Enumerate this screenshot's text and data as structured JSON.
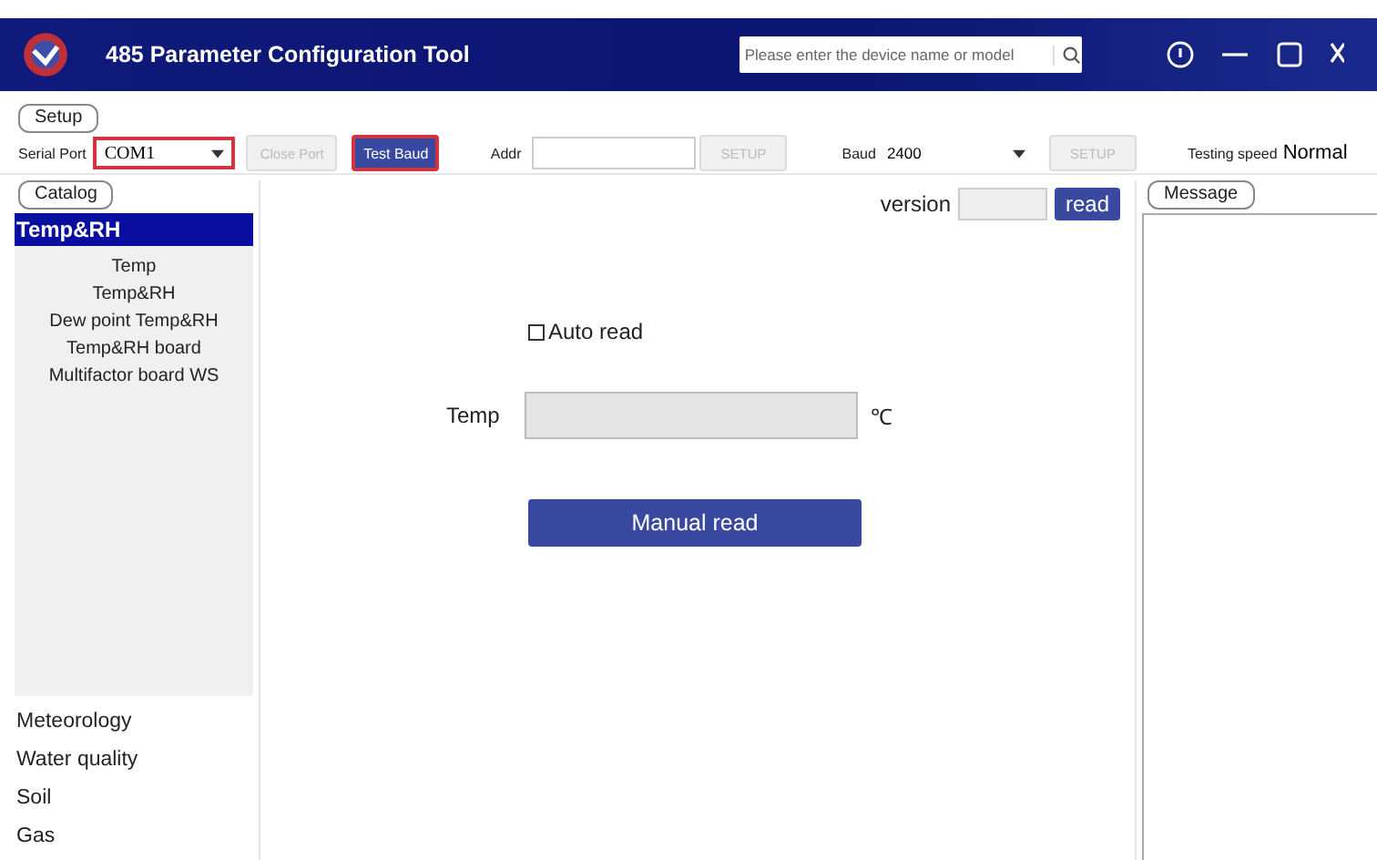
{
  "window": {
    "title": "485 Parameter Configuration Tool"
  },
  "search": {
    "placeholder": "Please enter the device name or model"
  },
  "setup": {
    "title": "Setup",
    "serial_port": {
      "label": "Serial Port",
      "value": "COM1",
      "highlighted": true
    },
    "close_port": {
      "label": "Close Port",
      "disabled": true
    },
    "test_baud": {
      "label": "Test Baud",
      "highlighted": true
    },
    "addr": {
      "label": "Addr",
      "setup": "SETUP"
    },
    "baud": {
      "label": "Baud",
      "value": "2400",
      "setup": "SETUP"
    },
    "testing_speed": {
      "label": "Testing speed",
      "value": "Normal"
    }
  },
  "catalog": {
    "title": "Catalog",
    "categories": [
      {
        "label": "Temp&RH",
        "selected": true,
        "children": [
          {
            "label": "Temp"
          },
          {
            "label": "Temp&RH"
          },
          {
            "label": "Dew point Temp&RH"
          },
          {
            "label": "Temp&RH board"
          },
          {
            "label": "Multifactor board WS"
          }
        ]
      },
      {
        "label": "Meteorology",
        "selected": false
      },
      {
        "label": "Water quality",
        "selected": false
      },
      {
        "label": "Soil",
        "selected": false
      },
      {
        "label": "Gas",
        "selected": false
      }
    ]
  },
  "main": {
    "version_label": "version",
    "read_button": "read",
    "auto_read": {
      "label": "Auto read",
      "checked": false
    },
    "temp": {
      "label": "Temp",
      "unit": "℃"
    },
    "manual_read": "Manual read"
  },
  "message": {
    "title": "Message"
  }
}
